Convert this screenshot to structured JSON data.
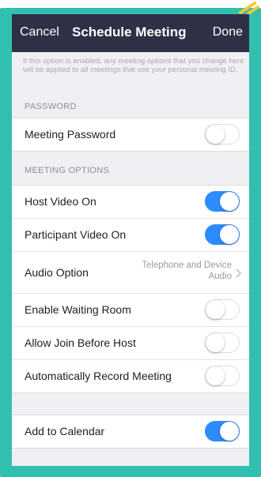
{
  "nav": {
    "cancel": "Cancel",
    "title": "Schedule Meeting",
    "done": "Done"
  },
  "note": "If this option is enabled, any meeting options that you change here will be applied to all meetings that use your personal meeting ID.",
  "password_section": {
    "header": "PASSWORD",
    "rows": [
      {
        "label": "Meeting Password",
        "on": false
      }
    ]
  },
  "options_section": {
    "header": "MEETING OPTIONS",
    "host_video": {
      "label": "Host Video On",
      "on": true
    },
    "participant_video": {
      "label": "Participant Video On",
      "on": true
    },
    "audio_option": {
      "label": "Audio Option",
      "value_line1": "Telephone and Device",
      "value_line2": "Audio"
    },
    "waiting_room": {
      "label": "Enable Waiting Room",
      "on": false
    },
    "join_before_host": {
      "label": "Allow Join Before Host",
      "on": false
    },
    "auto_record": {
      "label": "Automatically Record Meeting",
      "on": false
    }
  },
  "calendar_section": {
    "add_to_calendar": {
      "label": "Add to Calendar",
      "on": true
    }
  },
  "colors": {
    "frame": "#31c0b0",
    "navbar": "#2e3146",
    "toggle_on": "#2d8cff",
    "corner_mark": "#f3c73a"
  }
}
